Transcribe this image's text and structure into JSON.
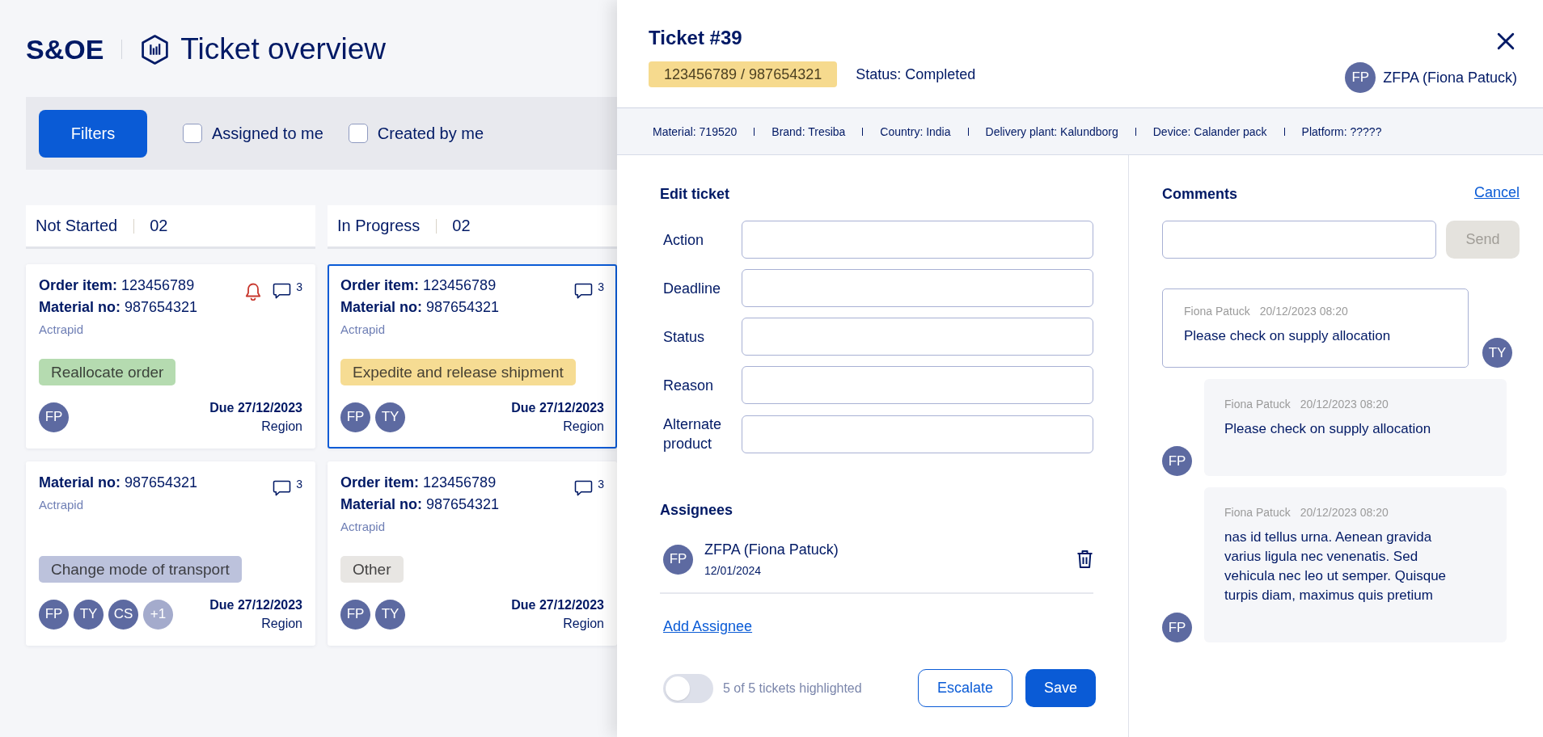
{
  "header": {
    "brand": "S&OE",
    "title": "Ticket overview"
  },
  "filter_bar": {
    "button": "Filters",
    "checkboxes": [
      {
        "label": "Assigned to me",
        "checked": false
      },
      {
        "label": "Created by me",
        "checked": false
      }
    ]
  },
  "columns": [
    {
      "title": "Not Started",
      "count": "02",
      "cards": [
        {
          "details": [
            {
              "label": "Order item:",
              "value": "123456789"
            },
            {
              "label": "Material no:",
              "value": "987654321"
            }
          ],
          "product": "Actrapid",
          "alert": true,
          "comment_count": "3",
          "tag": {
            "label": "Reallocate order",
            "color": "#b5dbb0"
          },
          "avatars": [
            "FP"
          ],
          "due": "Due 27/12/2023",
          "region": "Region",
          "selected": false
        },
        {
          "details": [
            {
              "label": "Material no:",
              "value": "987654321"
            }
          ],
          "product": "Actrapid",
          "alert": false,
          "comment_count": "3",
          "tag": {
            "label": "Change mode of transport",
            "color": "#bcc2dc"
          },
          "avatars": [
            "FP",
            "TY",
            "CS"
          ],
          "more_avatars": "+1",
          "due": "Due 27/12/2023",
          "region": "Region",
          "selected": false
        }
      ]
    },
    {
      "title": "In Progress",
      "count": "02",
      "cards": [
        {
          "details": [
            {
              "label": "Order item:",
              "value": "123456789"
            },
            {
              "label": "Material no:",
              "value": "987654321"
            }
          ],
          "product": "Actrapid",
          "alert": false,
          "comment_count": "3",
          "tag": {
            "label": "Expedite and release shipment",
            "color": "#f6dc93"
          },
          "avatars": [
            "FP",
            "TY"
          ],
          "due": "Due 27/12/2023",
          "region": "Region",
          "selected": true
        },
        {
          "details": [
            {
              "label": "Order item:",
              "value": "123456789"
            },
            {
              "label": "Material no:",
              "value": "987654321"
            }
          ],
          "product": "Actrapid",
          "alert": false,
          "comment_count": "3",
          "tag": {
            "label": "Other",
            "color": "#e8e6e3"
          },
          "avatars": [
            "FP",
            "TY"
          ],
          "due": "Due 27/12/2023",
          "region": "Region",
          "selected": false
        }
      ]
    }
  ],
  "ticket_panel": {
    "title": "Ticket #39",
    "ids": "123456789 / 987654321",
    "status": "Status: Completed",
    "owner": {
      "initials": "FP",
      "name": "ZFPA (Fiona Patuck)"
    },
    "info": [
      "Material: 719520",
      "Brand: Tresiba",
      "Country: India",
      "Delivery plant: Kalundborg",
      "Device: Calander pack",
      "Platform: ?????"
    ],
    "edit": {
      "title": "Edit ticket",
      "fields": [
        {
          "label": "Action"
        },
        {
          "label": "Deadline"
        },
        {
          "label": "Status"
        },
        {
          "label": "Reason"
        },
        {
          "label": "Alternate product"
        }
      ]
    },
    "assignees": {
      "title": "Assignees",
      "items": [
        {
          "initials": "FP",
          "name": "ZFPA (Fiona Patuck)",
          "date": "12/01/2024"
        }
      ],
      "add_link": "Add Assignee"
    },
    "highlight": {
      "on": false,
      "label": "5 of 5 tickets highlighted"
    },
    "escalate_button": "Escalate",
    "save_button": "Save",
    "comments": {
      "title": "Comments",
      "cancel": "Cancel",
      "send": {
        "label": "Send",
        "disabled": true
      },
      "items": [
        {
          "kind": "sent",
          "author": "Fiona Patuck",
          "time": "20/12/2023 08:20",
          "text": "Please check on supply allocation",
          "initials": "TY"
        },
        {
          "kind": "received",
          "author": "Fiona Patuck",
          "time": "20/12/2023 08:20",
          "text": "Please check on supply allocation",
          "initials": "FP"
        },
        {
          "kind": "received",
          "author": "Fiona Patuck",
          "time": "20/12/2023 08:20",
          "text": "nas id tellus urna. Aenean gravida varius ligula nec venenatis. Sed vehicula nec leo ut semper. Quisque turpis diam, maximus quis pretium",
          "initials": "FP"
        }
      ]
    }
  }
}
